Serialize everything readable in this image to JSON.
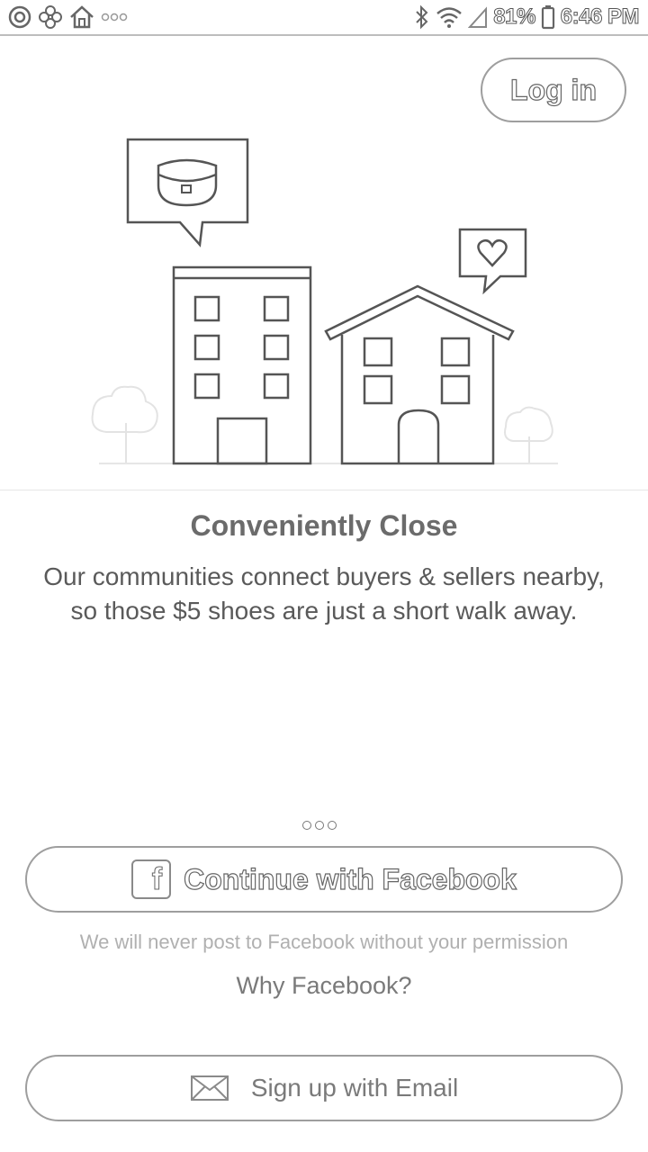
{
  "status_bar": {
    "battery_percent": "81%",
    "time": "6:46 PM",
    "left_icons": [
      "record-icon",
      "pinwheel-icon",
      "home-icon",
      "more-notifications-icon"
    ],
    "right_icons": [
      "bluetooth-icon",
      "wifi-icon",
      "signal-icon",
      "battery-icon"
    ]
  },
  "header": {
    "login_label": "Log in"
  },
  "illustration": {
    "elements": [
      "handbag-speech-bubble",
      "heart-speech-bubble",
      "apartment-building",
      "house",
      "tree-left",
      "tree-right"
    ]
  },
  "onboarding": {
    "title": "Conveniently Close",
    "description": "Our communities connect buyers & sellers nearby,\nso those $5 shoes are just a short walk away.",
    "page_count": 3,
    "active_page": 3
  },
  "actions": {
    "facebook_label": "Continue with Facebook",
    "facebook_icon": "facebook-icon",
    "permission_note": "We will never post to Facebook without your permission",
    "why_facebook": "Why Facebook?",
    "email_label": "Sign up with Email",
    "email_icon": "envelope-icon"
  }
}
